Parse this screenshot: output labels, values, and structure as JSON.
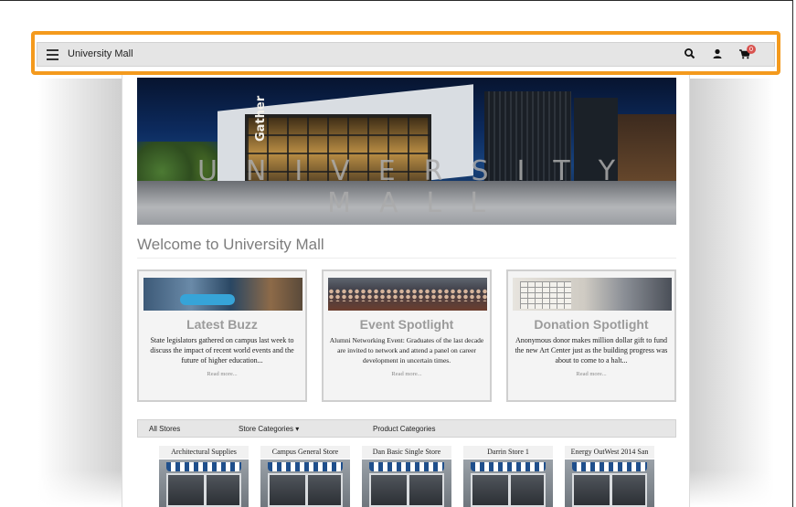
{
  "header": {
    "site_title": "University Mall",
    "menu_icon": "hamburger-menu-icon",
    "search_icon": "search-icon",
    "account_icon": "user-icon",
    "cart_icon": "shopping-cart-icon",
    "cart_count": "0"
  },
  "banner": {
    "sign_text": "Gather",
    "overlay_text": "UNIVERSITY MALL"
  },
  "welcome": "Welcome to University Mall",
  "cards": [
    {
      "title": "Latest Buzz",
      "body": "State legislators gathered on campus last week to discuss the impact of recent world events and the future of higher education...",
      "more": "Read more..."
    },
    {
      "title": "Event Spotlight",
      "body": "Alumni Networking Event: Graduates of the last decade are invited to network and attend a panel on career development in uncertain times.",
      "more": "Read more..."
    },
    {
      "title": "Donation Spotlight",
      "body": "Anonymous donor makes million dollar gift to fund the new Art Center just as the building progress was about to come to a halt...",
      "more": "Read more..."
    }
  ],
  "stores_nav": {
    "all_stores": "All Stores",
    "store_categories": "Store Categories ▾",
    "product_categories": "Product Categories"
  },
  "stores": [
    "Architectural Supplies",
    "Campus General Store",
    "Dan Basic Single Store",
    "Darrin Store 1",
    "Energy OutWest 2014 San"
  ],
  "colors": {
    "highlight_border": "#f49a1d",
    "header_bg": "#e5e5e5",
    "cart_badge": "#d9534f",
    "card_title": "#9b9b9b"
  }
}
